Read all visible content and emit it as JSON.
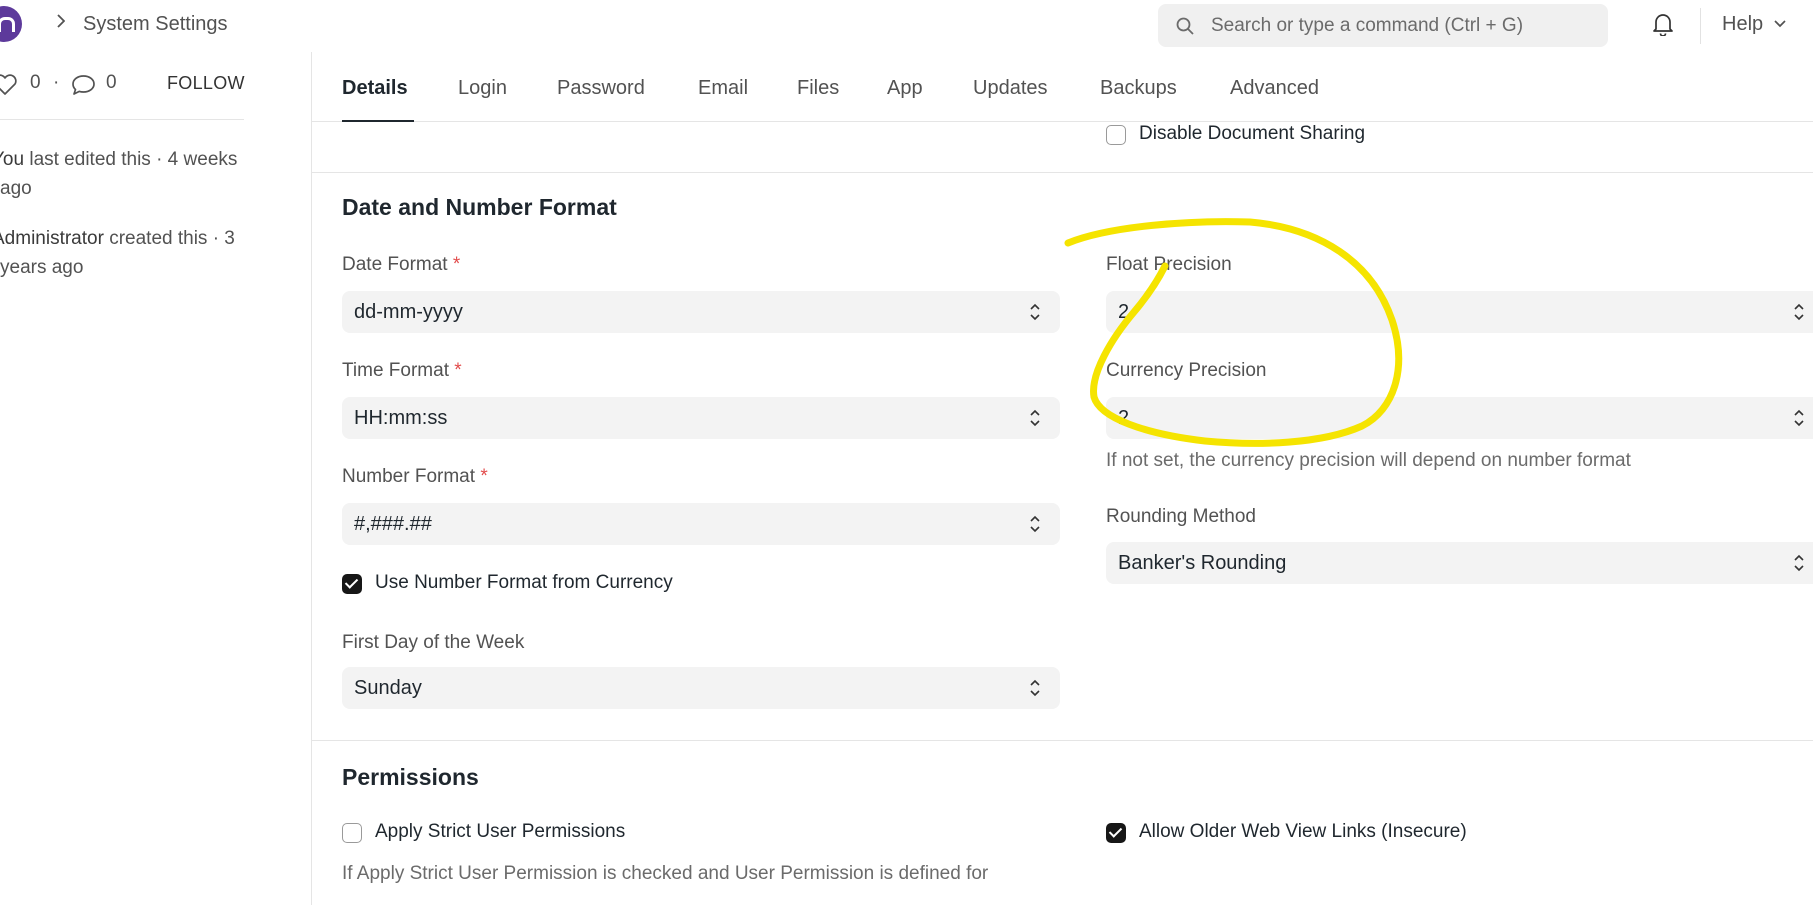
{
  "navbar": {
    "breadcrumb_title": "System Settings",
    "search_placeholder": "Search or type a command (Ctrl + G)",
    "help_label": "Help",
    "brand_color": "#5d3a9b"
  },
  "sidebar": {
    "like_count": "0",
    "separator": "·",
    "comment_count": "0",
    "follow_label": "FOLLOW",
    "activity": [
      {
        "actor": "You",
        "text": " last edited this · 4 weeks ago"
      },
      {
        "actor": "Administrator",
        "text": " created this · 3 years ago"
      }
    ]
  },
  "tabs": [
    {
      "label": "Details",
      "active": true
    },
    {
      "label": "Login"
    },
    {
      "label": "Password"
    },
    {
      "label": "Email"
    },
    {
      "label": "Files"
    },
    {
      "label": "App"
    },
    {
      "label": "Updates"
    },
    {
      "label": "Backups"
    },
    {
      "label": "Advanced"
    }
  ],
  "top_checkbox": {
    "label": "Disable Document Sharing",
    "checked": false
  },
  "date_number_section": {
    "title": "Date and Number Format",
    "required_mark": "*",
    "date_format": {
      "label": "Date Format",
      "value": "dd-mm-yyyy"
    },
    "time_format": {
      "label": "Time Format",
      "value": "HH:mm:ss"
    },
    "number_format": {
      "label": "Number Format",
      "value": "#,###.##"
    },
    "use_number_format": {
      "label": "Use Number Format from Currency",
      "checked": true
    },
    "first_day": {
      "label": "First Day of the Week",
      "value": "Sunday"
    },
    "float_precision": {
      "label": "Float Precision",
      "value": "2"
    },
    "currency_precision": {
      "label": "Currency Precision",
      "value": "2",
      "description": "If not set, the currency precision will depend on number format"
    },
    "rounding_method": {
      "label": "Rounding Method",
      "value": "Banker's Rounding"
    }
  },
  "permissions_section": {
    "title": "Permissions",
    "strict_user_permissions": {
      "label": "Apply Strict User Permissions",
      "checked": false
    },
    "strict_description": "If Apply Strict User Permission is checked and User Permission is defined for",
    "allow_older_links": {
      "label": "Allow Older Web View Links (Insecure)",
      "checked": true
    }
  },
  "annotation_color": "#f5e400"
}
